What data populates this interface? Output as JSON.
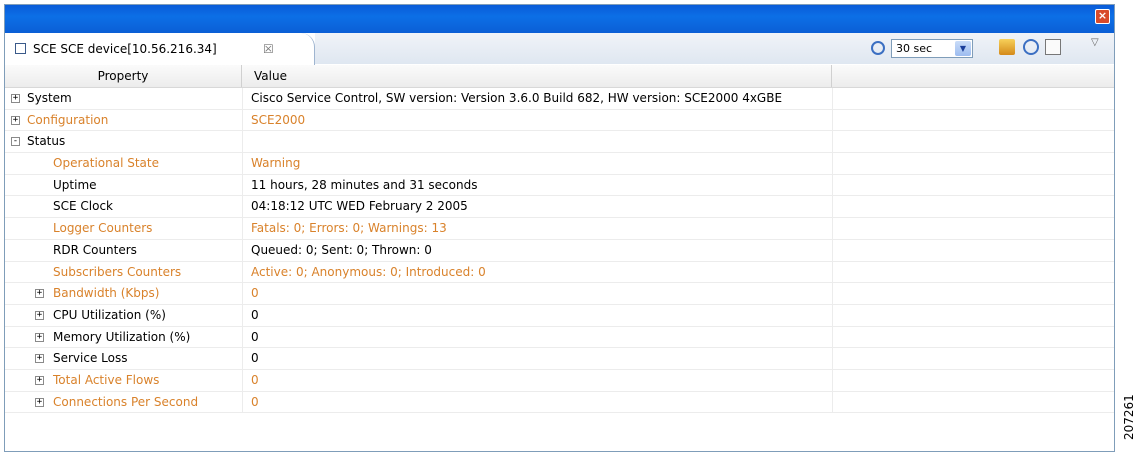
{
  "window": {
    "close_glyph": "×"
  },
  "tab": {
    "title": "SCE SCE device[10.56.216.34]",
    "close_glyph": "☒"
  },
  "toolbar": {
    "interval": "30 sec",
    "dropdown_glyph": "▼",
    "menu_glyph": "▽"
  },
  "columns": {
    "property": "Property",
    "value": "Value"
  },
  "rows": [
    {
      "label": "System",
      "value": "Cisco Service Control, SW version: Version 3.6.0 Build 682, HW version: SCE2000 4xGBE",
      "level": 0,
      "expander": "+",
      "highlight": false
    },
    {
      "label": "Configuration",
      "value": "SCE2000",
      "level": 0,
      "expander": "+",
      "highlight": true
    },
    {
      "label": "Status",
      "value": "",
      "level": 0,
      "expander": "-",
      "highlight": false
    },
    {
      "label": "Operational State",
      "value": "Warning",
      "level": 1,
      "expander": "",
      "highlight": true
    },
    {
      "label": "Uptime",
      "value": "11 hours, 28 minutes and 31 seconds",
      "level": 1,
      "expander": "",
      "highlight": false
    },
    {
      "label": "SCE Clock",
      "value": "04:18:12 UTC WED February 2 2005",
      "level": 1,
      "expander": "",
      "highlight": false
    },
    {
      "label": "Logger Counters",
      "value": "Fatals: 0; Errors: 0; Warnings: 13",
      "level": 1,
      "expander": "",
      "highlight": true
    },
    {
      "label": "RDR Counters",
      "value": "Queued: 0; Sent: 0; Thrown: 0",
      "level": 1,
      "expander": "",
      "highlight": false
    },
    {
      "label": "Subscribers Counters",
      "value": "Active: 0; Anonymous: 0; Introduced: 0",
      "level": 1,
      "expander": "",
      "highlight": true
    },
    {
      "label": "Bandwidth (Kbps)",
      "value": "0",
      "level": 2,
      "expander": "+",
      "highlight": true
    },
    {
      "label": "CPU Utilization (%)",
      "value": "0",
      "level": 2,
      "expander": "+",
      "highlight": false
    },
    {
      "label": "Memory Utilization (%)",
      "value": "0",
      "level": 2,
      "expander": "+",
      "highlight": false
    },
    {
      "label": "Service Loss",
      "value": "0",
      "level": 2,
      "expander": "+",
      "highlight": false
    },
    {
      "label": "Total Active Flows",
      "value": "0",
      "level": 2,
      "expander": "+",
      "highlight": true
    },
    {
      "label": "Connections Per Second",
      "value": "0",
      "level": 2,
      "expander": "+",
      "highlight": true
    }
  ],
  "watermark": "207261",
  "colors": {
    "highlight": "#d9822b",
    "titlebar": "#0a5bd8"
  }
}
